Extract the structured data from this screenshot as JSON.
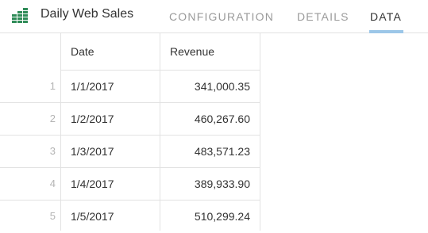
{
  "header": {
    "title": "Daily Web Sales",
    "icon": "spreadsheet-icon",
    "icon_color": "#2e8b57",
    "tabs": [
      {
        "label": "CONFIGURATION",
        "active": false
      },
      {
        "label": "DETAILS",
        "active": false
      },
      {
        "label": "DATA",
        "active": true
      }
    ],
    "active_underline_color": "#9cc7e8"
  },
  "table": {
    "columns": [
      "Date",
      "Revenue"
    ],
    "rows": [
      {
        "index": "1",
        "date": "1/1/2017",
        "revenue": "341,000.35"
      },
      {
        "index": "2",
        "date": "1/2/2017",
        "revenue": "460,267.60"
      },
      {
        "index": "3",
        "date": "1/3/2017",
        "revenue": "483,571.23"
      },
      {
        "index": "4",
        "date": "1/4/2017",
        "revenue": "389,933.90"
      },
      {
        "index": "5",
        "date": "1/5/2017",
        "revenue": "510,299.24"
      }
    ]
  }
}
